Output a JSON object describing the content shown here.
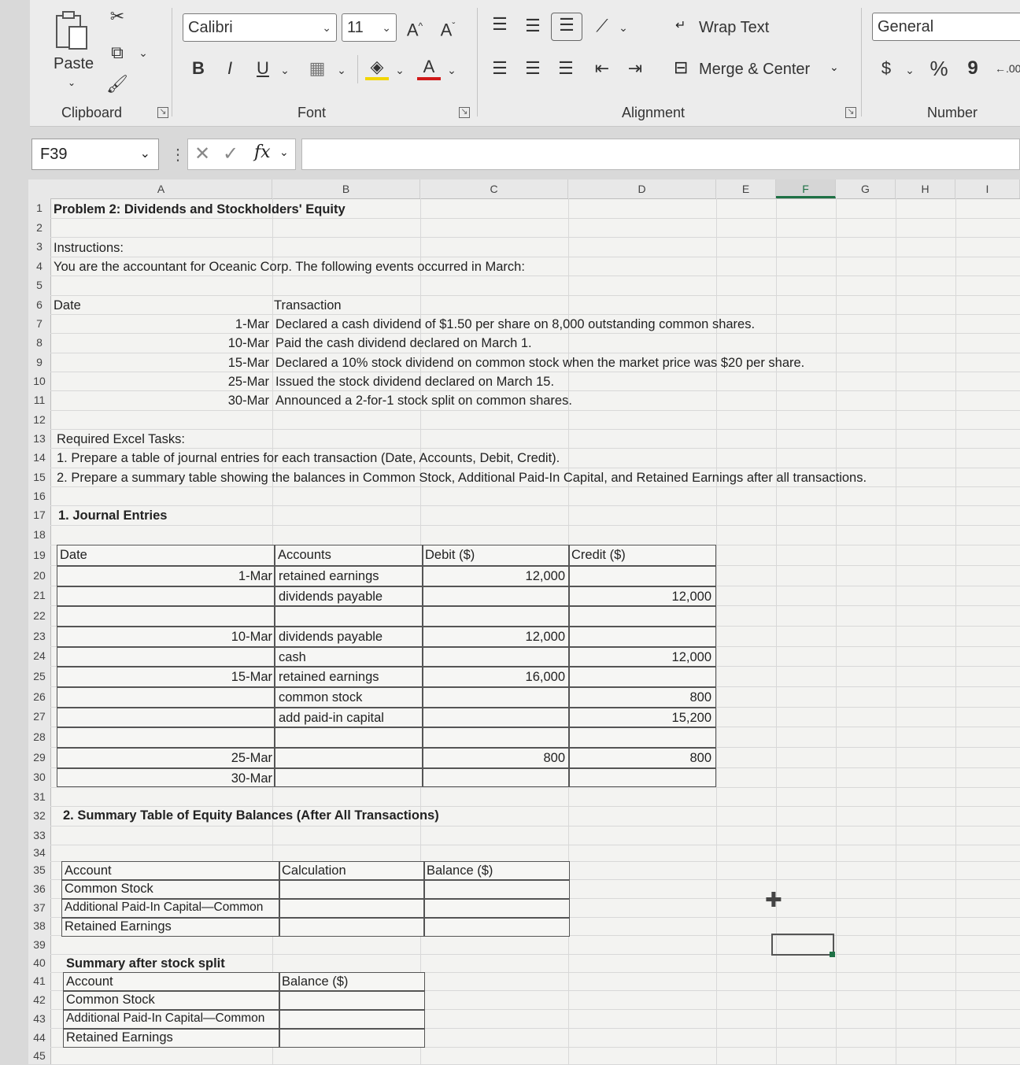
{
  "ribbon": {
    "clipboard": {
      "paste_label": "Paste",
      "group_label": "Clipboard"
    },
    "font": {
      "font_name": "Calibri",
      "font_size": "11",
      "grow": "A^",
      "shrink": "Aˇ",
      "bold": "B",
      "italic": "I",
      "underline": "U",
      "group_label": "Font"
    },
    "alignment": {
      "wrap_text": "Wrap Text",
      "merge_center": "Merge & Center",
      "group_label": "Alignment"
    },
    "number": {
      "format": "General",
      "currency": "$",
      "percent": "%",
      "comma": "9",
      "group_label": "Number"
    }
  },
  "formula_bar": {
    "name_box": "F39",
    "fx": "fx",
    "value": ""
  },
  "columns": [
    "A",
    "B",
    "C",
    "D",
    "E",
    "F",
    "G",
    "H",
    "I"
  ],
  "rows": [
    "1",
    "2",
    "3",
    "4",
    "5",
    "6",
    "7",
    "8",
    "9",
    "10",
    "11",
    "12",
    "13",
    "14",
    "15",
    "16",
    "17",
    "18",
    "19",
    "20",
    "21",
    "22",
    "23",
    "24",
    "25",
    "26",
    "27",
    "28",
    "29",
    "30",
    "31",
    "32",
    "33",
    "34",
    "35",
    "36",
    "37",
    "38",
    "39",
    "40",
    "41",
    "42",
    "43",
    "44",
    "45"
  ],
  "sheet": {
    "title": "Problem 2: Dividends and Stockholders' Equity",
    "instructions_label": "Instructions:",
    "intro": "You are the accountant for Oceanic Corp. The following events occurred in March:",
    "events_header": {
      "date": "Date",
      "transaction": "Transaction"
    },
    "events": [
      {
        "date": "1-Mar",
        "text": "Declared a cash dividend of $1.50 per share on 8,000 outstanding common shares."
      },
      {
        "date": "10-Mar",
        "text": "Paid the cash dividend declared on March 1."
      },
      {
        "date": "15-Mar",
        "text": "Declared a 10% stock dividend on common stock when the market price was $20 per share."
      },
      {
        "date": "25-Mar",
        "text": "Issued the stock dividend declared on March 15."
      },
      {
        "date": "30-Mar",
        "text": "Announced a 2-for-1 stock split on common shares."
      }
    ],
    "tasks_label": "Required Excel Tasks:",
    "task1": "1. Prepare a table of journal entries for each transaction (Date, Accounts, Debit, Credit).",
    "task2": "2. Prepare a summary table showing the balances in Common Stock, Additional Paid-In Capital, and Retained Earnings after all transactions.",
    "journal_title": "1. Journal Entries",
    "journal_headers": {
      "date": "Date",
      "accounts": "Accounts",
      "debit": "Debit ($)",
      "credit": "Credit ($)"
    },
    "journal_rows": [
      {
        "date": "1-Mar",
        "account": "retained earnings",
        "debit": "12,000",
        "credit": ""
      },
      {
        "date": "",
        "account": "dividends payable",
        "debit": "",
        "credit": "12,000"
      },
      {
        "date": "",
        "account": "",
        "debit": "",
        "credit": ""
      },
      {
        "date": "10-Mar",
        "account": "dividends payable",
        "debit": "12,000",
        "credit": ""
      },
      {
        "date": "",
        "account": "cash",
        "debit": "",
        "credit": "12,000"
      },
      {
        "date": "15-Mar",
        "account": "retained earnings",
        "debit": "16,000",
        "credit": ""
      },
      {
        "date": "",
        "account": "common stock",
        "debit": "",
        "credit": "800"
      },
      {
        "date": "",
        "account": "add paid-in capital",
        "debit": "",
        "credit": "15,200"
      },
      {
        "date": "",
        "account": "",
        "debit": "",
        "credit": ""
      },
      {
        "date": "25-Mar",
        "account": "",
        "debit": "800",
        "credit": "800"
      },
      {
        "date": "30-Mar",
        "account": "",
        "debit": "",
        "credit": ""
      }
    ],
    "summary_title": "2. Summary Table of Equity Balances (After All Transactions)",
    "summary_headers": {
      "account": "Account",
      "calculation": "Calculation",
      "balance": "Balance ($)"
    },
    "summary_rows": [
      "Common Stock",
      "Additional Paid-In Capital—Common",
      "Retained Earnings"
    ],
    "split_title": "Summary after stock split",
    "split_headers": {
      "account": "Account",
      "balance": "Balance ($)"
    },
    "split_rows": [
      "Common Stock",
      "Additional Paid-In Capital—Common",
      "Retained Earnings"
    ]
  }
}
